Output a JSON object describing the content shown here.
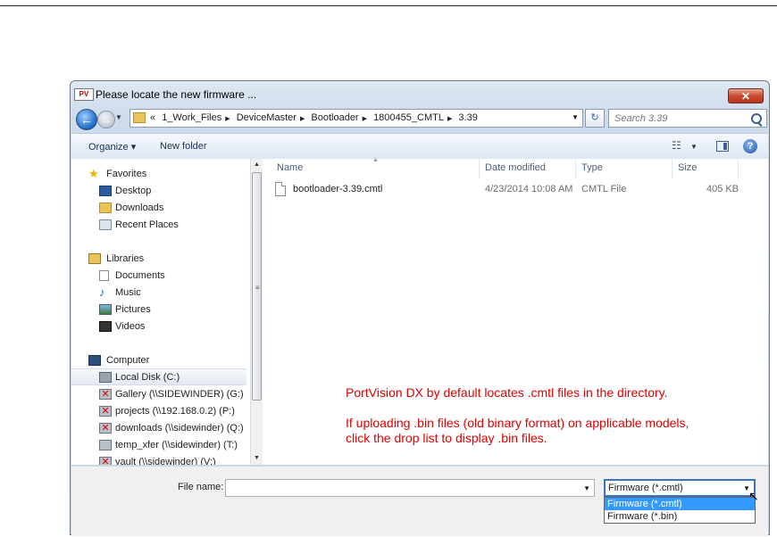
{
  "window": {
    "app_icon_text": "PV",
    "title": "Please locate the new firmware ...",
    "close_glyph": "✕"
  },
  "address": {
    "prefix": "«",
    "crumbs": [
      "1_Work_Files",
      "DeviceMaster",
      "Bootloader",
      "1800455_CMTL",
      "3.39"
    ],
    "search_placeholder": "Search 3.39"
  },
  "toolbar": {
    "organize_label": "Organize ▾",
    "new_folder_label": "New folder"
  },
  "nav": {
    "items": [
      {
        "label": "Favorites",
        "icon": "star-icon",
        "indent": 0
      },
      {
        "label": "Desktop",
        "icon": "desktop-icon",
        "indent": 1
      },
      {
        "label": "Downloads",
        "icon": "downloads-icon",
        "indent": 1
      },
      {
        "label": "Recent Places",
        "icon": "recent-places-icon",
        "indent": 1
      },
      {
        "label": "Libraries",
        "icon": "library-icon",
        "indent": 0
      },
      {
        "label": "Documents",
        "icon": "documents-icon",
        "indent": 1
      },
      {
        "label": "Music",
        "icon": "music-icon",
        "indent": 1
      },
      {
        "label": "Pictures",
        "icon": "pictures-icon",
        "indent": 1
      },
      {
        "label": "Videos",
        "icon": "videos-icon",
        "indent": 1
      },
      {
        "label": "Computer",
        "icon": "computer-icon",
        "indent": 0
      },
      {
        "label": "Local Disk (C:)",
        "icon": "disk-icon",
        "indent": 1,
        "selected": true
      },
      {
        "label": "Gallery (\\\\SIDEWINDER) (G:)",
        "icon": "network-drive-disconnected-icon",
        "indent": 1
      },
      {
        "label": "projects (\\\\192.168.0.2) (P:)",
        "icon": "network-drive-disconnected-icon",
        "indent": 1
      },
      {
        "label": "downloads (\\\\sidewinder) (Q:)",
        "icon": "network-drive-disconnected-icon",
        "indent": 1
      },
      {
        "label": "temp_xfer (\\\\sidewinder) (T:)",
        "icon": "network-drive-icon",
        "indent": 1
      },
      {
        "label": "vault (\\\\sidewinder) (V:)",
        "icon": "network-drive-disconnected-icon",
        "indent": 1
      }
    ]
  },
  "files": {
    "columns": [
      "Name",
      "Date modified",
      "Type",
      "Size"
    ],
    "rows": [
      {
        "name": "bootloader-3.39.cmtl",
        "date": "4/23/2014 10:08 AM",
        "type": "CMTL File",
        "size": "405 KB"
      }
    ]
  },
  "annotation": {
    "line1": "PortVision DX by default locates .cmtl files in the directory.",
    "line2": "If uploading .bin files (old binary format) on applicable models,",
    "line3": "click the drop list to display .bin files."
  },
  "footer": {
    "file_name_label": "File name:",
    "file_name_value": "",
    "file_type_selected": "Firmware (*.cmtl)",
    "file_type_options": [
      "Firmware (*.cmtl)",
      "Firmware (*.bin)"
    ]
  },
  "colors": {
    "annotation": "#e00000",
    "selection": "#3399ff"
  }
}
